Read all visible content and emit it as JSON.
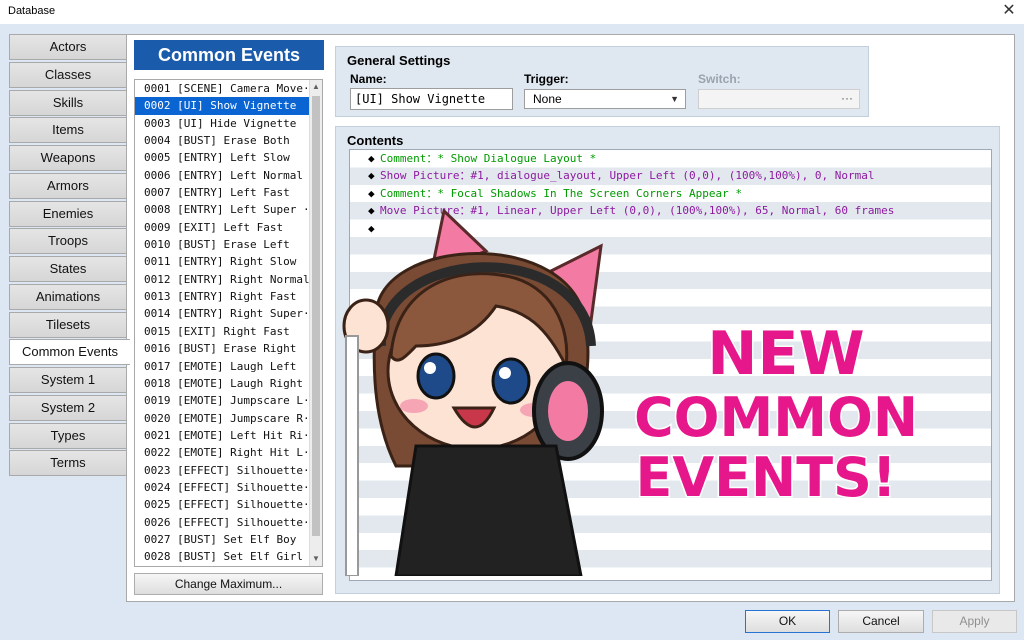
{
  "window": {
    "title": "Database",
    "close_glyph": "✕"
  },
  "tabs": [
    {
      "label": "Actors"
    },
    {
      "label": "Classes"
    },
    {
      "label": "Skills"
    },
    {
      "label": "Items"
    },
    {
      "label": "Weapons"
    },
    {
      "label": "Armors"
    },
    {
      "label": "Enemies"
    },
    {
      "label": "Troops"
    },
    {
      "label": "States"
    },
    {
      "label": "Animations"
    },
    {
      "label": "Tilesets"
    },
    {
      "label": "Common Events"
    },
    {
      "label": "System 1"
    },
    {
      "label": "System 2"
    },
    {
      "label": "Types"
    },
    {
      "label": "Terms"
    }
  ],
  "active_tab": "Common Events",
  "list": {
    "title": "Common Events",
    "selected_index": 1,
    "items": [
      "0001 [SCENE] Camera Move···",
      "0002 [UI] Show Vignette",
      "0003 [UI] Hide Vignette",
      "0004 [BUST] Erase Both",
      "0005 [ENTRY] Left Slow",
      "0006 [ENTRY] Left Normal",
      "0007 [ENTRY] Left Fast",
      "0008 [ENTRY] Left Super ···",
      "0009 [EXIT] Left Fast",
      "0010 [BUST] Erase Left",
      "0011 [ENTRY] Right Slow",
      "0012 [ENTRY] Right Normal",
      "0013 [ENTRY] Right Fast",
      "0014 [ENTRY] Right Super···",
      "0015 [EXIT] Right Fast",
      "0016 [BUST] Erase Right",
      "0017 [EMOTE] Laugh Left",
      "0018 [EMOTE] Laugh Right",
      "0019 [EMOTE] Jumpscare L···",
      "0020 [EMOTE] Jumpscare R···",
      "0021 [EMOTE] Left Hit Ri···",
      "0022 [EMOTE] Right Hit L···",
      "0023 [EFFECT] Silhouette···",
      "0024 [EFFECT] Silhouette···",
      "0025 [EFFECT] Silhouette···",
      "0026 [EFFECT] Silhouette···",
      "0027 [BUST] Set Elf Boy",
      "0028 [BUST] Set Elf Girl"
    ],
    "change_max_label": "Change Maximum..."
  },
  "general": {
    "title": "General Settings",
    "name_label": "Name:",
    "name_value": "[UI] Show Vignette",
    "trigger_label": "Trigger:",
    "trigger_value": "None",
    "switch_label": "Switch:",
    "switch_button": "···"
  },
  "contents": {
    "title": "Contents",
    "lines": [
      {
        "text": "Comment：* Show Dialogue Layout *",
        "color": "#009a00"
      },
      {
        "text": "Show Picture：#1, dialogue_layout, Upper Left (0,0), (100%,100%), 0, Normal",
        "color": "#8c1aa0"
      },
      {
        "text": "Comment：* Focal Shadows In The Screen Corners Appear *",
        "color": "#009a00"
      },
      {
        "text": "Move Picture：#1, Linear, Upper Left (0,0), (100%,100%), 65, Normal, 60 frames",
        "color": "#8c1aa0"
      },
      {
        "text": "",
        "color": "#000000"
      }
    ],
    "bullet": "◆"
  },
  "promo": {
    "lines": [
      "NEW",
      "COMMON",
      "EVENTS!"
    ],
    "color": "#e6178b"
  },
  "buttons": {
    "ok": "OK",
    "cancel": "Cancel",
    "apply": "Apply"
  }
}
